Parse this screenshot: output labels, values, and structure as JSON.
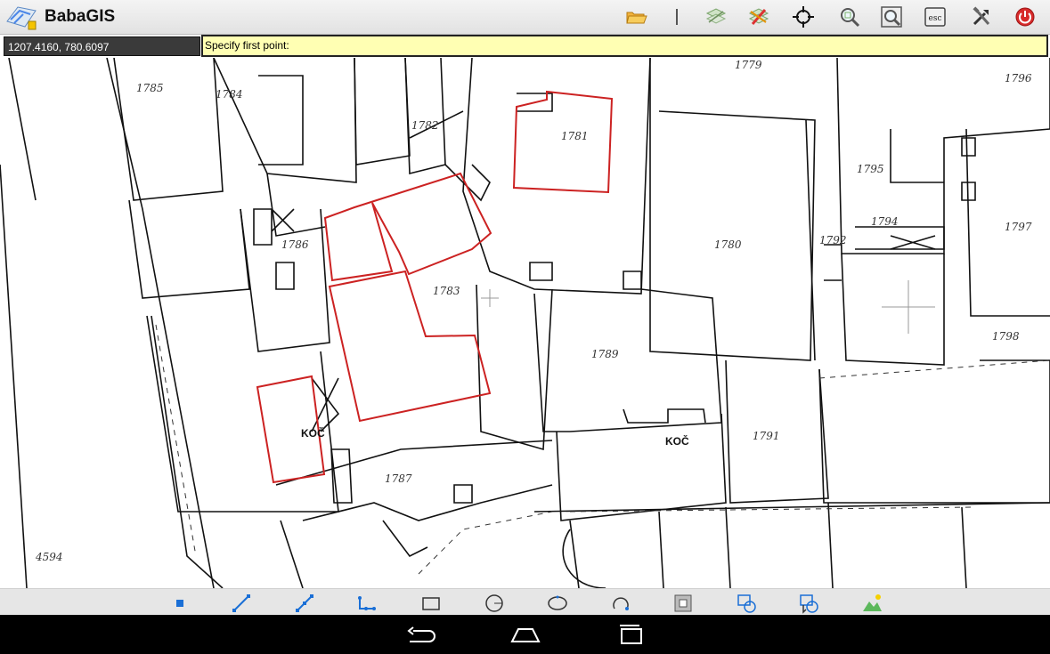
{
  "app": {
    "title": "BabaGIS"
  },
  "toolbar": {
    "icons": [
      "folder-open-icon",
      "separator",
      "layers-icon",
      "edit-layer-icon",
      "gps-target-icon",
      "zoom-window-icon",
      "zoom-extent-icon",
      "esc-icon",
      "tools-icon",
      "power-icon"
    ],
    "esc_label": "esc"
  },
  "status": {
    "coordinates": "1207.4160, 780.6097",
    "prompt": "Specify first point:"
  },
  "map": {
    "parcel_labels": [
      {
        "text": "1785"
      },
      {
        "text": "1784"
      },
      {
        "text": "1782"
      },
      {
        "text": "1781"
      },
      {
        "text": "1779"
      },
      {
        "text": "1796"
      },
      {
        "text": "1795"
      },
      {
        "text": "1794"
      },
      {
        "text": "1797"
      },
      {
        "text": "1780"
      },
      {
        "text": "1792"
      },
      {
        "text": "1786"
      },
      {
        "text": "1783"
      },
      {
        "text": "1789"
      },
      {
        "text": "1798"
      },
      {
        "text": "1791"
      },
      {
        "text": "1787"
      },
      {
        "text": "4594"
      }
    ],
    "koc_labels": [
      "KOČ",
      "KOČ"
    ],
    "highlight_color": "#cc2222"
  },
  "draw_tools": [
    "point-tool-icon",
    "line-tool-icon",
    "polyline-tool-icon",
    "polygon-node-tool-icon",
    "rectangle-tool-icon",
    "circle-tool-icon",
    "ellipse-tool-icon",
    "arc-tool-icon",
    "hatch-tool-icon",
    "select-tool-icon",
    "attribute-tool-icon",
    "terrain-tool-icon"
  ],
  "nav": [
    "back-icon",
    "home-icon",
    "recents-icon"
  ]
}
